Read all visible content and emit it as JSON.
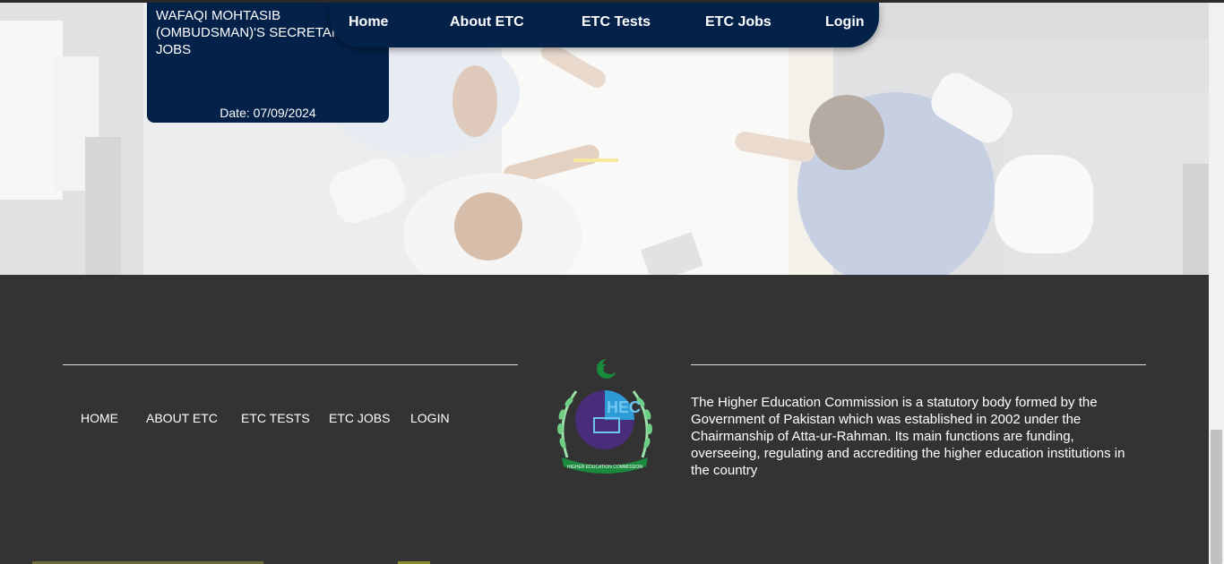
{
  "job_card": {
    "title": "WAFAQI MOHTASIB (OMBUDSMAN)'S SECRETARIAT JOBS",
    "date": "Date: 07/09/2024"
  },
  "nav": {
    "items": [
      "Home",
      "About ETC",
      "ETC Tests",
      "ETC Jobs",
      "Login"
    ]
  },
  "footer": {
    "links": [
      "HOME",
      "ABOUT ETC",
      "ETC TESTS",
      "ETC JOBS",
      "LOGIN"
    ],
    "logo": {
      "name": "hec-logo",
      "text_main": "HEC",
      "text_ring": "HIGHER EDUCATION COMMISSION"
    },
    "description": "The Higher Education Commission is a statutory body formed by the Government of Pakistan which was established in 2002 under the Chairmanship of Atta-ur-Rahman. Its main functions are funding, overseeing, regulating and accrediting the higher education institutions in the country"
  },
  "colors": {
    "navy": "#04214a",
    "footer_bg": "#333333",
    "logo_green": "#1a8a3c",
    "logo_purple": "#4a2d7a"
  }
}
